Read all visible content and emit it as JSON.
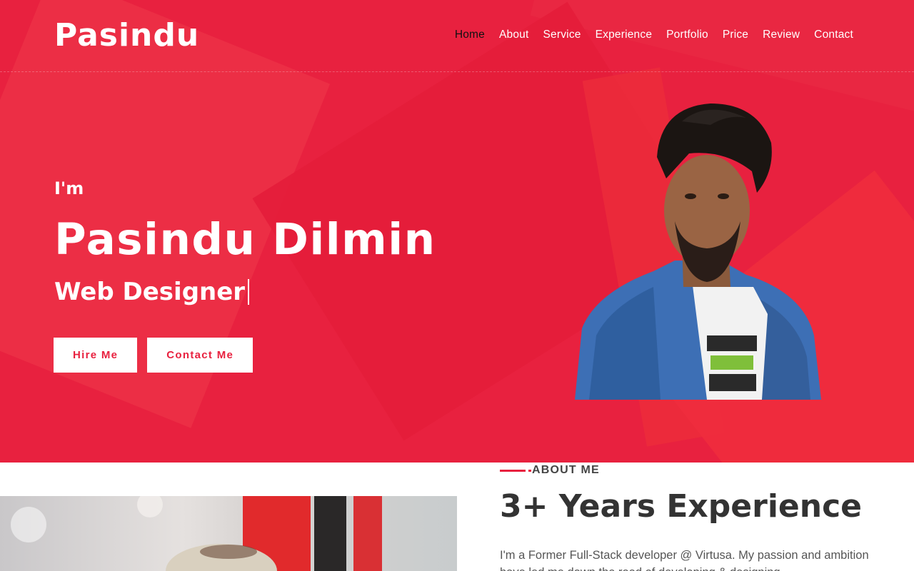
{
  "brand": {
    "logo": "Pasindu"
  },
  "nav": {
    "items": [
      {
        "label": "Home",
        "active": true
      },
      {
        "label": "About"
      },
      {
        "label": "Service"
      },
      {
        "label": "Experience"
      },
      {
        "label": "Portfolio"
      },
      {
        "label": "Price"
      },
      {
        "label": "Review"
      },
      {
        "label": "Contact"
      }
    ]
  },
  "hero": {
    "greeting": "I'm",
    "name": "Pasindu Dilmin",
    "role": "Web Designer",
    "hire_label": "Hire Me",
    "contact_label": "Contact Me"
  },
  "about": {
    "eyebrow": "ABOUT ME",
    "title": "3+ Years Experience",
    "text": "I'm a Former Full-Stack developer @ Virtusa. My passion and ambition have led me down the road of developing & designing"
  },
  "colors": {
    "accent": "#e8213f",
    "text_dark": "#333333",
    "nav_active": "#111111"
  }
}
